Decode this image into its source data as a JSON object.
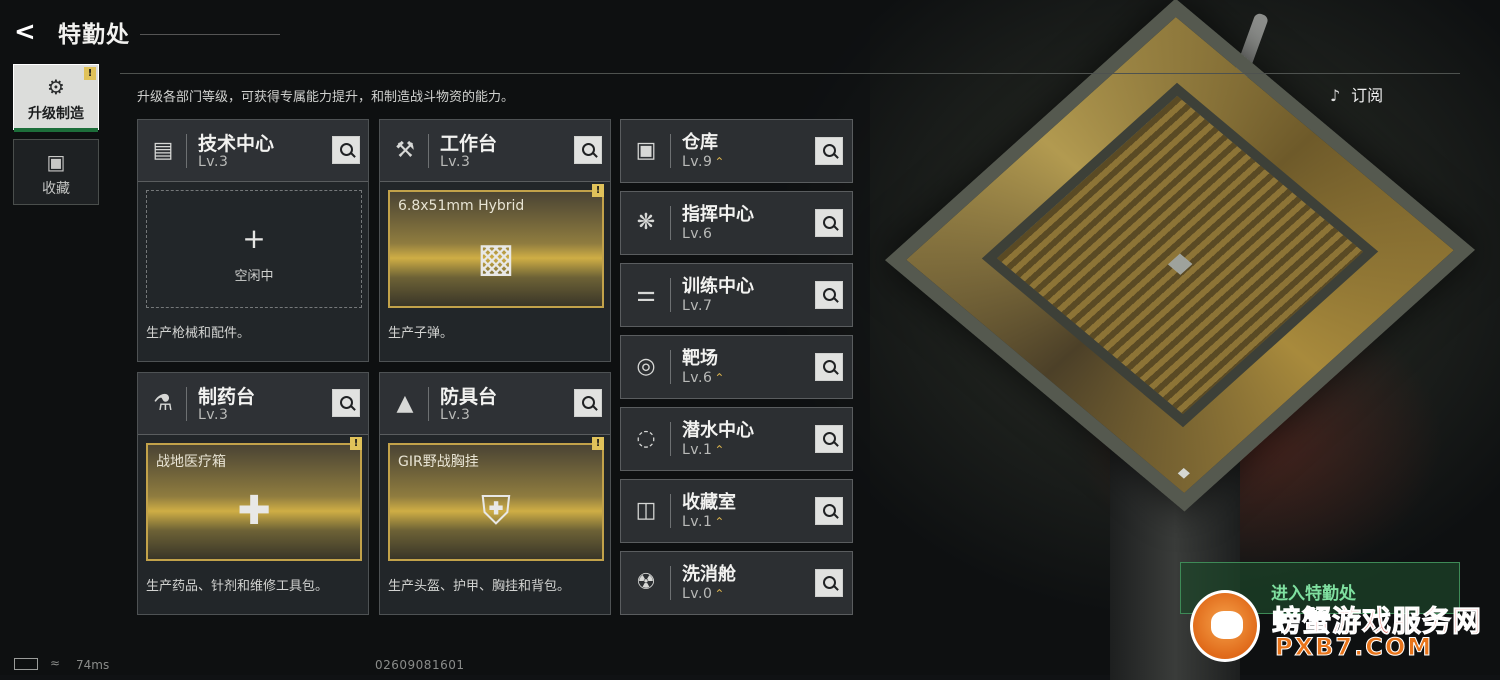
{
  "header": {
    "title": "特勤处",
    "back_icon": "back-arrow-icon"
  },
  "subscribe_label": "订阅",
  "sidenav": [
    {
      "label": "升级制造",
      "icon": "upgrade-craft-icon",
      "active": true,
      "alert": "!"
    },
    {
      "label": "收藏",
      "icon": "collection-icon",
      "active": false
    }
  ],
  "description": "升级各部门等级，可获得专属能力提升，和制造战斗物资的能力。",
  "production_cards": [
    {
      "name": "技术中心",
      "level": "Lv.3",
      "icon": "tech-center-icon",
      "status": "idle",
      "slot_plus": "+",
      "slot_label": "空闲中",
      "desc": "生产枪械和配件。"
    },
    {
      "name": "工作台",
      "level": "Lv.3",
      "icon": "workbench-icon",
      "status": "producing",
      "alert": "!",
      "product": "6.8x51mm Hybrid",
      "desc": "生产子弹。"
    },
    {
      "name": "制药台",
      "level": "Lv.3",
      "icon": "pharmacy-icon",
      "status": "producing",
      "alert": "!",
      "product": "战地医疗箱",
      "desc": "生产药品、针剂和维修工具包。"
    },
    {
      "name": "防具台",
      "level": "Lv.3",
      "icon": "armor-bench-icon",
      "status": "producing",
      "alert": "!",
      "product": "GIR野战胸挂",
      "desc": "生产头盔、护甲、胸挂和背包。"
    }
  ],
  "facilities": [
    {
      "name": "仓库",
      "level": "Lv.9",
      "upgradable": true,
      "icon": "warehouse-icon"
    },
    {
      "name": "指挥中心",
      "level": "Lv.6",
      "upgradable": false,
      "icon": "command-center-icon"
    },
    {
      "name": "训练中心",
      "level": "Lv.7",
      "upgradable": false,
      "icon": "training-center-icon"
    },
    {
      "name": "靶场",
      "level": "Lv.6",
      "upgradable": true,
      "icon": "shooting-range-icon"
    },
    {
      "name": "潜水中心",
      "level": "Lv.1",
      "upgradable": true,
      "icon": "diving-center-icon"
    },
    {
      "name": "收藏室",
      "level": "Lv.1",
      "upgradable": true,
      "icon": "collection-room-icon"
    },
    {
      "name": "洗消舱",
      "level": "Lv.0",
      "upgradable": true,
      "icon": "decontamination-icon"
    }
  ],
  "enter_button": "进入特勤处",
  "status_bar": {
    "ping": "74ms",
    "uid": "02609081601"
  },
  "watermark": {
    "line1": "螃蟹游戏服务网",
    "line2": "PXB7.COM"
  },
  "colors": {
    "accent_gold": "#d7b04d",
    "enter_green": "#7fe0a0",
    "active_tab": "#dcdddb"
  }
}
